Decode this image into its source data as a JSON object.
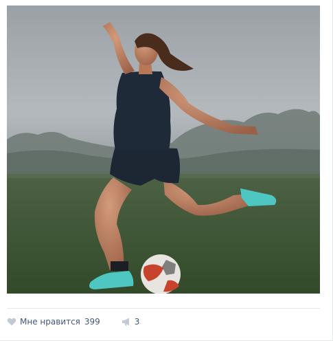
{
  "post": {
    "photo_icon": "football-player-photo",
    "like": {
      "icon": "heart-icon",
      "label": "Мне нравится",
      "count": "399"
    },
    "share": {
      "icon": "megaphone-icon",
      "count": "3"
    }
  },
  "colors": {
    "divider": "#e7e8ec",
    "icon": "#c1c9d4",
    "text": "#42577a"
  }
}
